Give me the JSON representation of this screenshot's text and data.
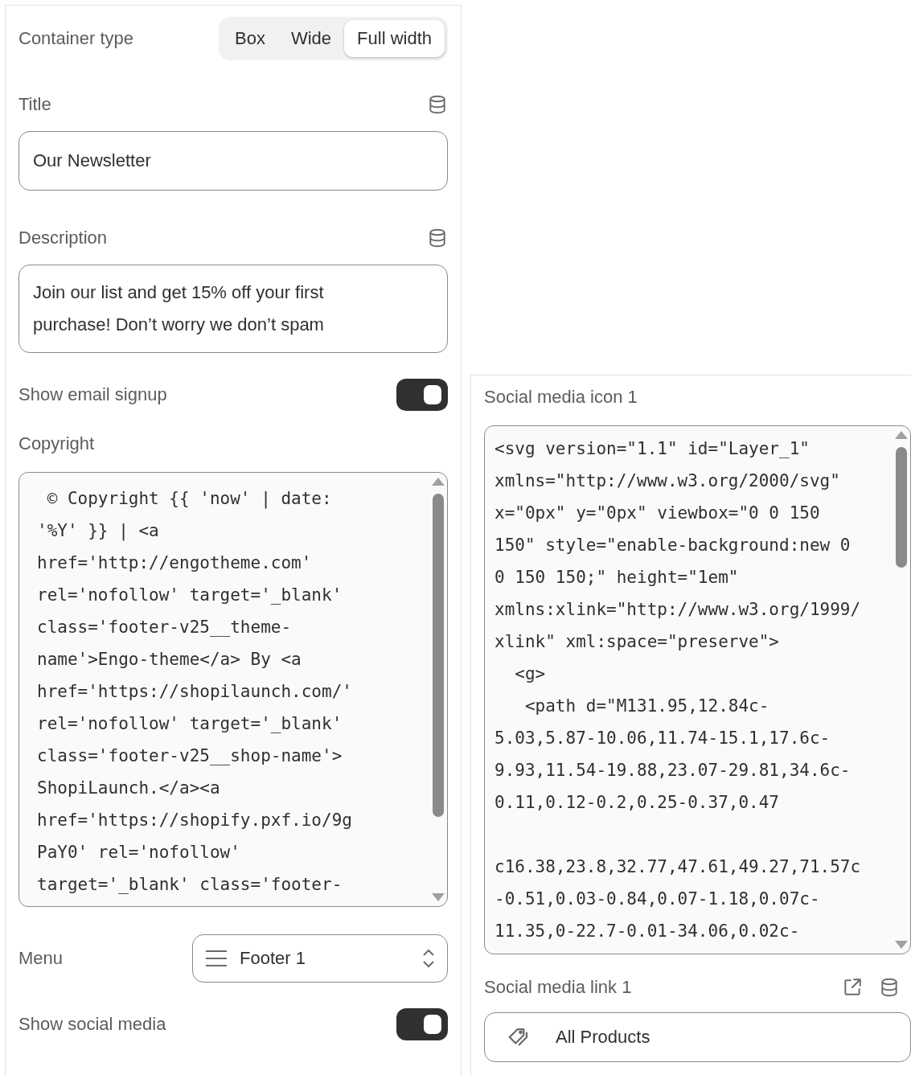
{
  "container_type": {
    "label": "Container type",
    "options": [
      {
        "label": "Box",
        "selected": false
      },
      {
        "label": "Wide",
        "selected": false
      },
      {
        "label": "Full width",
        "selected": true
      }
    ]
  },
  "title": {
    "label": "Title",
    "value": "Our Newsletter"
  },
  "description": {
    "label": "Description",
    "value": "Join our list and get 15% off your first\npurchase! Don’t worry we don’t spam"
  },
  "show_email_signup": {
    "label": "Show email signup",
    "on": true
  },
  "copyright": {
    "label": "Copyright",
    "value": " © Copyright {{ 'now' | date:\n'%Y' }} | <a\nhref='http://engotheme.com'\nrel='nofollow' target='_blank'\nclass='footer-v25__theme-\nname'>Engo-theme</a> By <a\nhref='https://shopilaunch.com/'\nrel='nofollow' target='_blank'\nclass='footer-v25__shop-name'>\nShopiLaunch.</a><a\nhref='https://shopify.pxf.io/9g\nPaY0' rel='nofollow'\ntarget='_blank' class='footer-"
  },
  "menu": {
    "label": "Menu",
    "value": "Footer 1"
  },
  "show_social_media": {
    "label": "Show social media",
    "on": true
  },
  "social_media_icon_1": {
    "label": "Social media icon 1",
    "value": "<svg version=\"1.1\" id=\"Layer_1\"\nxmlns=\"http://www.w3.org/2000/svg\"\nx=\"0px\" y=\"0px\" viewbox=\"0 0 150\n150\" style=\"enable-background:new 0\n0 150 150;\" height=\"1em\"\nxmlns:xlink=\"http://www.w3.org/1999/\nxlink\" xml:space=\"preserve\">\n  <g>\n   <path d=\"M131.95,12.84c-\n5.03,5.87-10.06,11.74-15.1,17.6c-\n9.93,11.54-19.88,23.07-29.81,34.6c-\n0.11,0.12-0.2,0.25-0.37,0.47\n\nc16.38,23.8,32.77,47.61,49.27,71.57c\n-0.51,0.03-0.84,0.07-1.18,0.07c-\n11.35,0-22.7-0.01-34.06,0.02c-"
  },
  "social_media_link_1": {
    "label": "Social media link 1",
    "value": "All Products"
  }
}
